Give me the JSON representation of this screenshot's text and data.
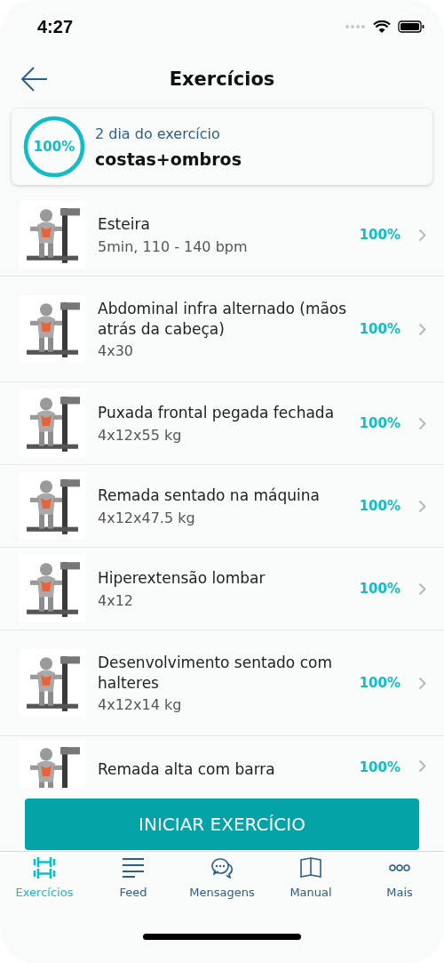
{
  "status_bar": {
    "time": "4:27"
  },
  "header": {
    "title": "Exercícios"
  },
  "summary": {
    "percent": "100%",
    "level": 1,
    "day": "2 dia do exercício",
    "name": "costas+ombros"
  },
  "exercises": [
    {
      "kind": "picture",
      "name": "Esteira",
      "detail": "5min, 110 - 140 bpm",
      "percent": "100%"
    },
    {
      "kind": "picture",
      "name": "Abdominal infra alternado (mãos atrás da cabeça)",
      "detail": "4x30",
      "percent": "100%"
    },
    {
      "kind": "picture",
      "name": "Puxada frontal pegada fechada",
      "detail": "4x12x55 kg",
      "percent": "100%"
    },
    {
      "kind": "picture",
      "name": "Remada sentado na máquina",
      "detail": "4x12x47.5 kg",
      "percent": "100%"
    },
    {
      "kind": "picture",
      "name": "Hiperextensão lombar",
      "detail": "4x12",
      "percent": "100%"
    },
    {
      "kind": "picture",
      "name": "Desenvolvimento sentado com halteres",
      "detail": "4x12x14 kg",
      "percent": "100%"
    },
    {
      "kind": "picture",
      "name": "Remada alta com barra",
      "percent": "100%"
    }
  ],
  "start_button": {
    "label": "INICIAR EXERCÍCIO"
  },
  "tab_bar": [
    {
      "kind": "dumbbells",
      "label": "Exercícios",
      "selected": true
    },
    {
      "kind": "lines",
      "label": "Feed",
      "selected": false
    },
    {
      "kind": "chat",
      "label": "Mensagens",
      "selected": false
    },
    {
      "kind": "book",
      "label": "Manual",
      "selected": false
    },
    {
      "kind": "dots",
      "label": "Mais",
      "selected": false
    }
  ]
}
